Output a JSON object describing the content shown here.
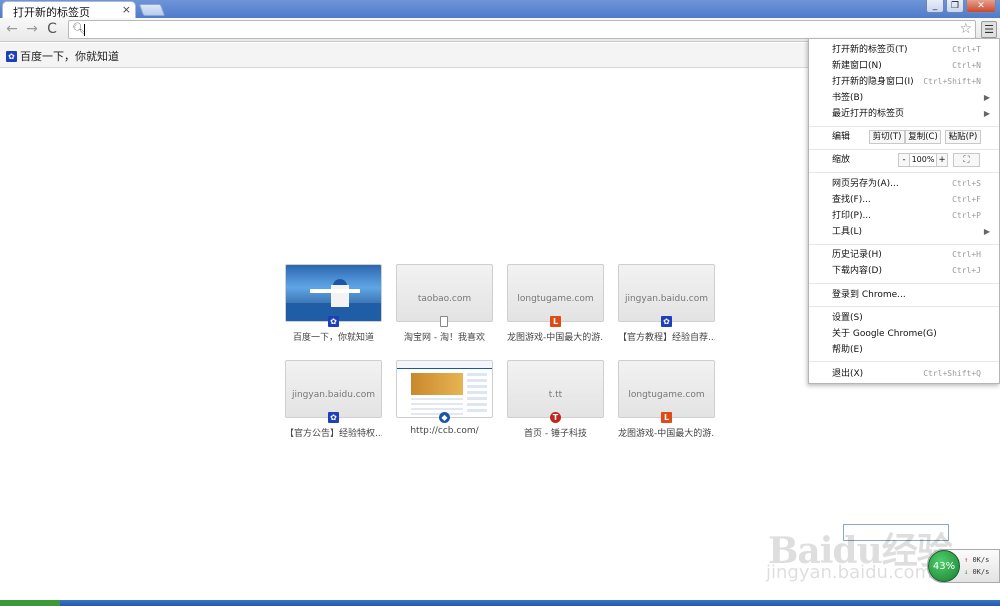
{
  "tab": {
    "title": "打开新的标签页",
    "close": "×"
  },
  "window": {
    "minimize": "_",
    "restore": "❐",
    "close": "✕"
  },
  "nav": {
    "back": "←",
    "forward": "→",
    "reload": "C"
  },
  "omnibox": {
    "value": ""
  },
  "bookmarks": [
    {
      "label": "百度一下，你就知道"
    }
  ],
  "thumbnails": [
    {
      "domain": "",
      "label": "百度一下，你就知道",
      "favicon": "baidu-paw",
      "shot": "baidu"
    },
    {
      "domain": "taobao.com",
      "label": "淘宝网 - 淘！我喜欢",
      "favicon": "document"
    },
    {
      "domain": "longtugame.com",
      "label": "龙图游戏-中国最大的游...",
      "favicon": "L"
    },
    {
      "domain": "jingyan.baidu.com",
      "label": "【官方教程】经验自荐...",
      "favicon": "baidu-paw"
    },
    {
      "domain": "jingyan.baidu.com",
      "label": "【官方公告】经验特权...",
      "favicon": "baidu-paw"
    },
    {
      "domain": "",
      "label": "http://ccb.com/",
      "favicon": "ccb",
      "shot": "ccb"
    },
    {
      "domain": "t.tt",
      "label": "首页 - 锤子科技",
      "favicon": "T"
    },
    {
      "domain": "longtugame.com",
      "label": "龙图游戏-中国最大的游...",
      "favicon": "L"
    }
  ],
  "menu": {
    "new_tab": {
      "label": "打开新的标签页(T)",
      "shortcut": "Ctrl+T"
    },
    "new_window": {
      "label": "新建窗口(N)",
      "shortcut": "Ctrl+N"
    },
    "incognito": {
      "label": "打开新的隐身窗口(I)",
      "shortcut": "Ctrl+Shift+N"
    },
    "bookmarks": {
      "label": "书签(B)"
    },
    "recent_tabs": {
      "label": "最近打开的标签页"
    },
    "edit": {
      "label": "编辑",
      "cut": "剪切(T)",
      "copy": "复制(C)",
      "paste": "粘贴(P)"
    },
    "zoom": {
      "label": "缩放",
      "minus": "-",
      "value": "100%",
      "plus": "+",
      "fullscreen": "⛶"
    },
    "save_as": {
      "label": "网页另存为(A)...",
      "shortcut": "Ctrl+S"
    },
    "find": {
      "label": "查找(F)...",
      "shortcut": "Ctrl+F"
    },
    "print": {
      "label": "打印(P)...",
      "shortcut": "Ctrl+P"
    },
    "tools": {
      "label": "工具(L)"
    },
    "history": {
      "label": "历史记录(H)",
      "shortcut": "Ctrl+H"
    },
    "downloads": {
      "label": "下载内容(D)",
      "shortcut": "Ctrl+J"
    },
    "signin": {
      "label": "登录到 Chrome..."
    },
    "settings": {
      "label": "设置(S)"
    },
    "about": {
      "label": "关于 Google Chrome(G)"
    },
    "help": {
      "label": "帮助(E)"
    },
    "exit": {
      "label": "退出(X)",
      "shortcut": "Ctrl+Shift+Q"
    }
  },
  "watermark": {
    "brand": "Baidu经验",
    "url": "jingyan.baidu.com"
  },
  "speed_widget": {
    "percent": "43%",
    "up": "0K/s",
    "down": "0K/s"
  }
}
